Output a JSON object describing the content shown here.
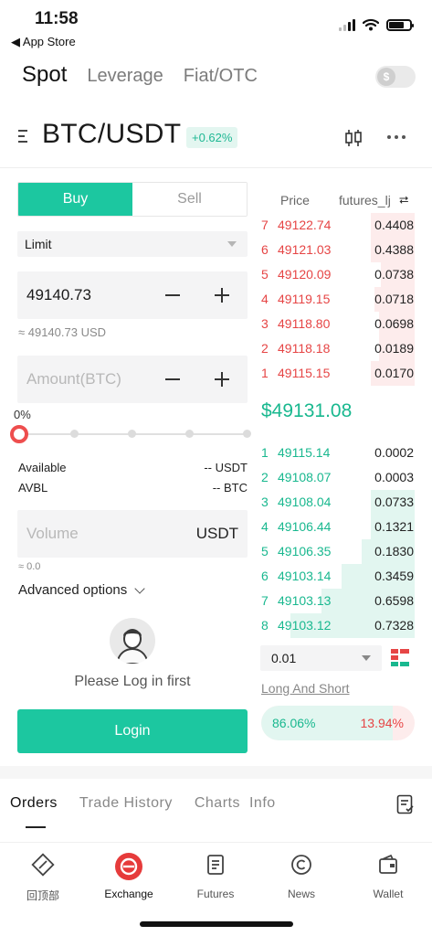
{
  "status_bar": {
    "time": "11:58",
    "back_label": "◀ App Store"
  },
  "top_tabs": [
    "Spot",
    "Leverage",
    "Fiat/OTC"
  ],
  "toggle_symbol": "$",
  "pair": {
    "name": "BTC/USDT",
    "change": "+0.62%"
  },
  "trade_form": {
    "buy_label": "Buy",
    "sell_label": "Sell",
    "order_type": "Limit",
    "price_value": "49140.73",
    "price_approx": "≈ 49140.73 USD",
    "amount_placeholder": "Amount(BTC)",
    "percent": "0%",
    "available_label": "Available",
    "available_value": "-- USDT",
    "avbl_label": "AVBL",
    "avbl_value": "-- BTC",
    "volume_placeholder": "Volume",
    "volume_unit": "USDT",
    "volume_approx": "≈ 0.0",
    "advanced_options": "Advanced options",
    "login_hint": "Please Log in first",
    "login_button": "Login"
  },
  "order_book": {
    "price_header": "Price",
    "user_header": "futures_lj",
    "swap_symbol": "⮂",
    "asks": [
      {
        "idx": "7",
        "price": "49122.74",
        "amount": "0.4408",
        "depth": 0.28
      },
      {
        "idx": "6",
        "price": "49121.03",
        "amount": "0.4388",
        "depth": 0.28
      },
      {
        "idx": "5",
        "price": "49120.09",
        "amount": "0.0738",
        "depth": 0.22
      },
      {
        "idx": "4",
        "price": "49119.15",
        "amount": "0.0718",
        "depth": 0.26
      },
      {
        "idx": "3",
        "price": "49118.80",
        "amount": "0.0698",
        "depth": 0.23
      },
      {
        "idx": "2",
        "price": "49118.18",
        "amount": "0.0189",
        "depth": 0.23
      },
      {
        "idx": "1",
        "price": "49115.15",
        "amount": "0.0170",
        "depth": 0.28
      }
    ],
    "last_price": "$49131.08",
    "bids": [
      {
        "idx": "1",
        "price": "49115.14",
        "amount": "0.0002",
        "depth": 0.0
      },
      {
        "idx": "2",
        "price": "49108.07",
        "amount": "0.0003",
        "depth": 0.0
      },
      {
        "idx": "3",
        "price": "49108.04",
        "amount": "0.0733",
        "depth": 0.28
      },
      {
        "idx": "4",
        "price": "49106.44",
        "amount": "0.1321",
        "depth": 0.28
      },
      {
        "idx": "5",
        "price": "49106.35",
        "amount": "0.1830",
        "depth": 0.34
      },
      {
        "idx": "6",
        "price": "49103.14",
        "amount": "0.3459",
        "depth": 0.47
      },
      {
        "idx": "7",
        "price": "49103.13",
        "amount": "0.6598",
        "depth": 0.6
      },
      {
        "idx": "8",
        "price": "49103.12",
        "amount": "0.7328",
        "depth": 0.8
      }
    ],
    "depth_value": "0.01",
    "long_short_label": "Long And Short",
    "long_pct": "86.06%",
    "short_pct": "13.94%",
    "long_fraction": 0.86
  },
  "bottom_tabs": [
    "Orders",
    "Trade History",
    "Charts",
    "Info"
  ],
  "tabbar": [
    {
      "label": "回顶部",
      "icon": "diamond-link-icon"
    },
    {
      "label": "Exchange",
      "icon": "exchange-icon"
    },
    {
      "label": "Futures",
      "icon": "futures-doc-icon"
    },
    {
      "label": "News",
      "icon": "news-c-icon"
    },
    {
      "label": "Wallet",
      "icon": "wallet-icon"
    }
  ],
  "colors": {
    "accent": "#1cc7a0",
    "ask": "#e64545",
    "bid": "#19b88f",
    "exchange_active": "#e63b3b"
  }
}
